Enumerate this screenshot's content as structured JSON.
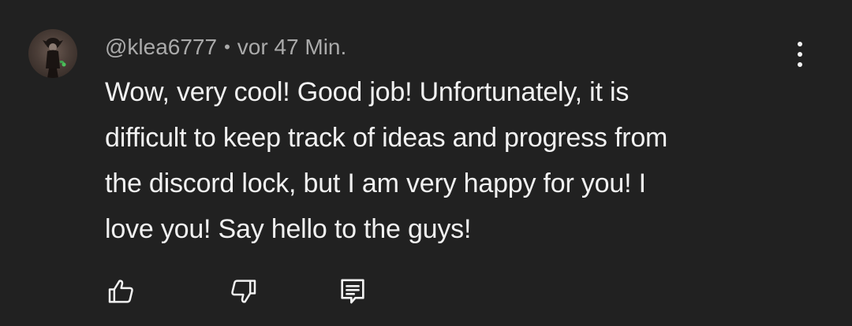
{
  "comment": {
    "author": "@klea6777",
    "separator": "•",
    "time": "vor 47 Min.",
    "text_lines": [
      "Wow, very cool! Good job! Unfortunately, it is",
      "difficult to keep track of ideas and progress from",
      "the discord lock, but I am very happy for you! I",
      "love you! Say hello to the guys!"
    ]
  },
  "actions": {
    "like_icon": "thumbs-up-icon",
    "dislike_icon": "thumbs-down-icon",
    "reply_icon": "comment-reply-icon",
    "menu_icon": "more-vert-icon"
  },
  "colors": {
    "background": "#212121",
    "text": "#f1f1f1",
    "meta": "#aaaaaa"
  }
}
